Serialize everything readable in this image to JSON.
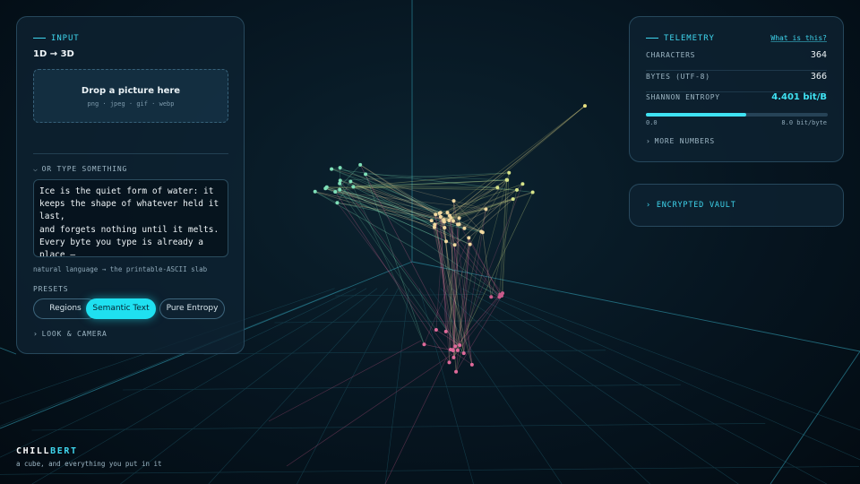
{
  "input": {
    "section_label": "INPUT",
    "subtitle": "1D → 3D",
    "dropzone": {
      "title": "Drop a picture here",
      "formats": "png · jpeg · gif · webp"
    },
    "type_toggle": "OR TYPE SOMETHING",
    "text_value": "Ice is the quiet form of water: it keeps the shape of whatever held it last,\nand forgets nothing until it melts.\nEvery byte you type is already a place —",
    "hint": "natural language → the printable-ASCII slab",
    "presets_label": "PRESETS",
    "presets": [
      {
        "label": "Regions",
        "active": false
      },
      {
        "label": "Semantic Text",
        "active": true
      },
      {
        "label": "Pure Entropy",
        "active": false
      }
    ],
    "look_camera": "LOOK & CAMERA"
  },
  "telemetry": {
    "section_label": "TELEMETRY",
    "help_link": "What is this?",
    "rows": [
      {
        "key": "CHARACTERS",
        "value": "364"
      },
      {
        "key": "BYTES (UTF-8)",
        "value": "366"
      },
      {
        "key": "SHANNON ENTROPY",
        "value": "4.401 bit/B"
      }
    ],
    "entropy_fraction": 0.55,
    "scale_min": "0.0",
    "scale_max": "8.0 bit/byte",
    "more_numbers": "MORE NUMBERS"
  },
  "vault": {
    "label": "ENCRYPTED VAULT"
  },
  "brand": {
    "name_a": "CHILL",
    "name_b": "BERT",
    "tagline": "a cube, and everything you put in it"
  },
  "colors": {
    "accent": "#3fe2f2",
    "active_preset": "#1fe0f0",
    "background": "#061520"
  },
  "icons": {
    "chevron": "chevron-right-icon",
    "toggle_open": "chevron-down-icon"
  }
}
